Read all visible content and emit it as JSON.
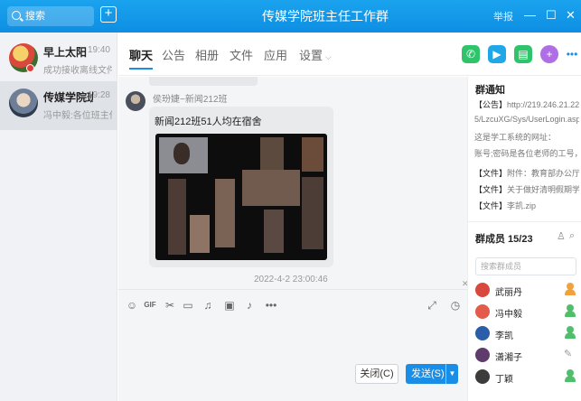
{
  "window": {
    "title": "传媒学院班主任工作群",
    "report_label": "举报",
    "controls": {
      "minimize": "—",
      "maximize": "☐",
      "close": "✕"
    }
  },
  "search": {
    "placeholder": "搜索"
  },
  "new_button": "+",
  "chat_list": [
    {
      "name": "早上太阳",
      "time": "19:40",
      "preview": "成功接收离线文件 “i"
    },
    {
      "name": "传媒学院班...",
      "time": "19:28",
      "preview": "冯中毅:各位班主任..."
    }
  ],
  "tabs": [
    {
      "label": "聊天",
      "active": true
    },
    {
      "label": "公告"
    },
    {
      "label": "相册"
    },
    {
      "label": "文件"
    },
    {
      "label": "应用"
    },
    {
      "label": "设置",
      "chevron": "⌵"
    }
  ],
  "header_icons": [
    "phone-icon",
    "video-icon",
    "screen-share-icon",
    "app-icon",
    "more-icon"
  ],
  "message": {
    "sender": "侯玢婕~新闻212班",
    "text": "新闻212班51人均在宿舍",
    "timestamp": "2022-4-2 23:00:46"
  },
  "input_toolbar": {
    "icons": [
      "emoji-icon",
      "gif-icon",
      "scissors-icon",
      "folder-icon",
      "music-icon",
      "image-icon",
      "bell-icon",
      "more-icon"
    ],
    "close_label": "关闭(C)",
    "send_label": "发送(S)",
    "send_arrow": "▼"
  },
  "notice": {
    "title": "群通知",
    "lines": [
      {
        "key": "【公告】",
        "text": "http://219.246.21.22"
      },
      {
        "key": "",
        "text": "5/LzcuXG/Sys/UserLogin.aspx"
      },
      {
        "key": "",
        "text": "这是学工系统的网址："
      },
      {
        "key": "",
        "text": "账号;密码是各位老师的工号，密..."
      },
      {
        "key": "【文件】",
        "text": "附件：教育部办公厅关..."
      },
      {
        "key": "【文件】",
        "text": "关于做好清明假期学生..."
      },
      {
        "key": "【文件】",
        "text": "李凯.zip"
      }
    ]
  },
  "members": {
    "title": "群成员 15/23",
    "search_placeholder": "搜索群成员",
    "list": [
      {
        "name": "武丽丹",
        "role": "owner"
      },
      {
        "name": "冯中毅",
        "role": "admin"
      },
      {
        "name": "李凯",
        "role": "admin"
      },
      {
        "name": "潇湘子",
        "role": "edit"
      },
      {
        "name": "丁颖",
        "role": "admin"
      }
    ]
  },
  "colors": {
    "accent": "#1a8ee6",
    "titlebar": "#0e8ee3",
    "owner": "#f2a23a",
    "admin": "#4fbf6a",
    "phone": "#2fc46b",
    "video": "#1fa7e8",
    "screen": "#2fc46b",
    "app": "#b06ee6"
  }
}
